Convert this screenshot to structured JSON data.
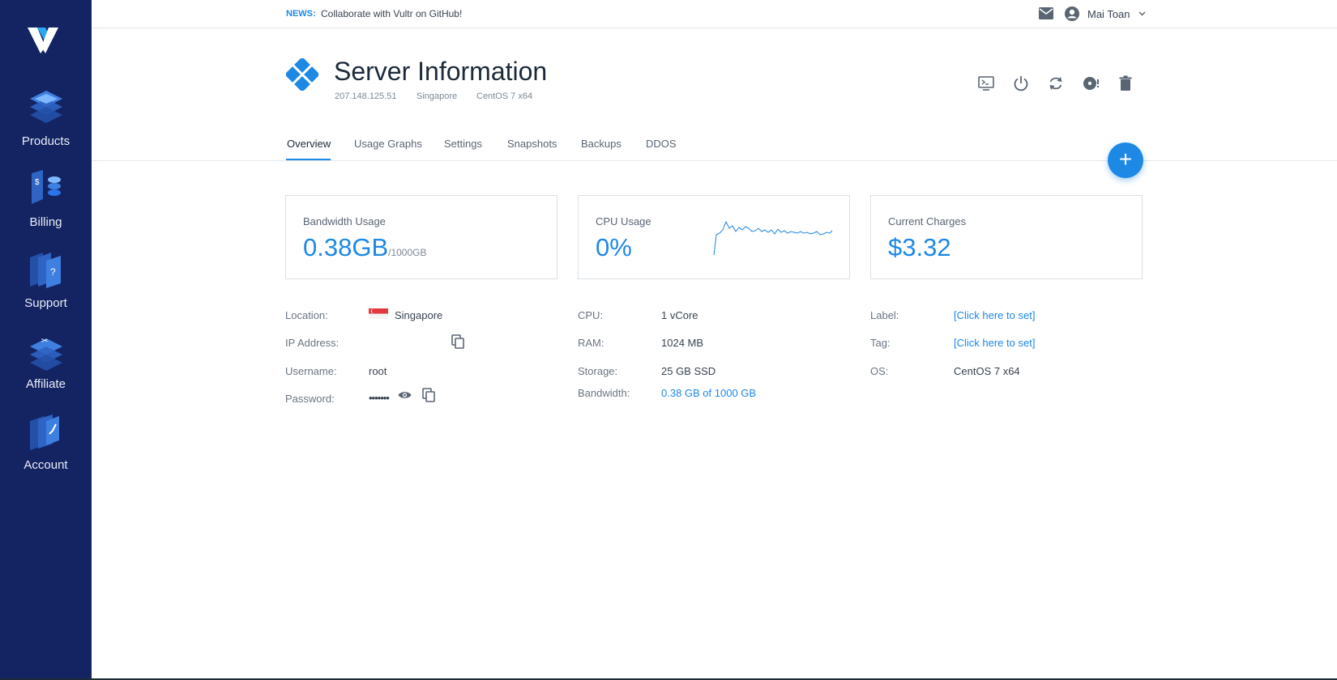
{
  "sidebar": {
    "items": [
      {
        "label": "Products",
        "icon": "products-icon"
      },
      {
        "label": "Billing",
        "icon": "billing-icon"
      },
      {
        "label": "Support",
        "icon": "support-icon"
      },
      {
        "label": "Affiliate",
        "icon": "affiliate-icon"
      },
      {
        "label": "Account",
        "icon": "account-icon"
      }
    ]
  },
  "topbar": {
    "news_tag": "NEWS:",
    "news_text": "Collaborate with Vultr on GitHub!",
    "user_name": "Mai Toan"
  },
  "header": {
    "title": "Server Information",
    "ip": "207.148.125.51",
    "location": "Singapore",
    "os": "CentOS 7 x64"
  },
  "actions": [
    "console-icon",
    "power-icon",
    "restart-icon",
    "reinstall-icon",
    "delete-icon"
  ],
  "tabs": [
    "Overview",
    "Usage Graphs",
    "Settings",
    "Snapshots",
    "Backups",
    "DDOS"
  ],
  "active_tab": "Overview",
  "fab_label": "+",
  "cards": {
    "bandwidth": {
      "label": "Bandwidth Usage",
      "value": "0.38GB",
      "unit": "/1000GB"
    },
    "cpu": {
      "label": "CPU Usage",
      "value": "0%"
    },
    "charges": {
      "label": "Current Charges",
      "value": "$3.32"
    }
  },
  "details": {
    "location_label": "Location:",
    "location_value": "Singapore",
    "ip_label": "IP Address:",
    "username_label": "Username:",
    "username_value": "root",
    "password_label": "Password:",
    "password_value": "•••••••",
    "cpu_label": "CPU:",
    "cpu_value": "1 vCore",
    "ram_label": "RAM:",
    "ram_value": "1024 MB",
    "storage_label": "Storage:",
    "storage_value": "25 GB SSD",
    "bandwidth_label": "Bandwidth:",
    "bandwidth_value": "0.38 GB of 1000 GB",
    "label_label": "Label:",
    "label_value": "[Click here to set]",
    "tag_label": "Tag:",
    "tag_value": "[Click here to set]",
    "os_label": "OS:",
    "os_value": "CentOS 7 x64"
  },
  "colors": {
    "sidebar_bg": "#142463",
    "accent": "#1e88e5"
  }
}
